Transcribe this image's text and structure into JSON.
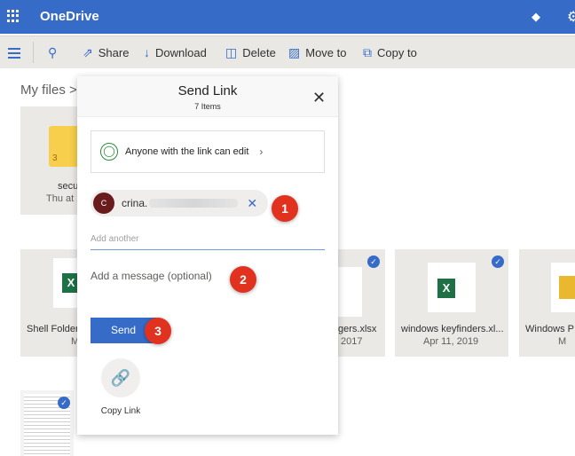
{
  "app": {
    "title": "OneDrive",
    "accent": "#366bc8"
  },
  "commandbar": {
    "items": [
      {
        "label": "Share",
        "icon": "share-icon"
      },
      {
        "label": "Download",
        "icon": "download-icon"
      },
      {
        "label": "Delete",
        "icon": "trash-icon"
      },
      {
        "label": "Move to",
        "icon": "move-icon"
      },
      {
        "label": "Copy to",
        "icon": "copy-icon"
      }
    ]
  },
  "breadcrumb": {
    "current": "My files",
    "separator": ">"
  },
  "tiles": [
    {
      "name": "secu",
      "sub": "Thu at 2",
      "type": "folder",
      "count": "3"
    },
    {
      "name": "Shell Folder",
      "sub": "M",
      "type": "xlsx"
    },
    {
      "name": "gers.xlsx",
      "sub": "2017",
      "type": "xlsx",
      "selected": true
    },
    {
      "name": "windows keyfinders.xl...",
      "sub": "Apr 11, 2019",
      "type": "xlsx",
      "selected": true
    },
    {
      "name": "Windows P",
      "sub": "M",
      "type": "zip"
    },
    {
      "name": "",
      "sub": "",
      "type": "document",
      "selected": true
    }
  ],
  "dialog": {
    "title": "Send Link",
    "subtitle": "7 Items",
    "permission": "Anyone with the link can edit",
    "recipient": {
      "initial": "C",
      "name": "crina."
    },
    "add_placeholder": "Add another",
    "message_placeholder": "Add a message (optional)",
    "send_label": "Send",
    "copy_link_label": "Copy Link"
  },
  "annotations": [
    "1",
    "2",
    "3"
  ]
}
